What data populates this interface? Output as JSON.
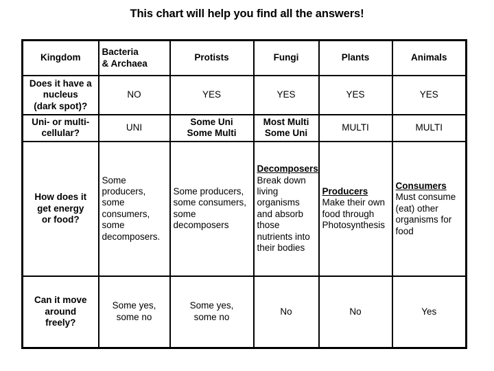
{
  "title": "This chart will help you find all the answers!",
  "chart_data": {
    "type": "table",
    "title": "This chart will help you find all the answers!",
    "columns": [
      "Kingdom",
      "Bacteria\n& Archaea",
      "Protists",
      "Fungi",
      "Plants",
      "Animals"
    ],
    "column_headers": {
      "col0": "Kingdom",
      "col1_line1": "Bacteria",
      "col1_line2": "& Archaea",
      "col2": "Protists",
      "col3": "Fungi",
      "col4": "Plants",
      "col5": "Animals"
    },
    "row_labels": [
      "Does it have a nucleus (dark spot)?",
      "Uni- or multi-cellular?",
      "How does it get energy or food?",
      "Can it move around freely?"
    ],
    "rows": [
      {
        "label_lines": [
          "Does it have a",
          "nucleus",
          "(dark spot)?"
        ],
        "cells": [
          "NO",
          "YES",
          "YES",
          "YES",
          "YES"
        ]
      },
      {
        "label_lines": [
          "Uni- or multi-",
          "cellular?"
        ],
        "cells": [
          "UNI",
          "Some Uni\nSome Multi",
          "Most Multi\nSome Uni",
          "MULTI",
          "MULTI"
        ]
      },
      {
        "label_lines": [
          "How does it",
          "get energy",
          "or food?"
        ],
        "cells": [
          {
            "role": "",
            "text": "Some producers, some consumers, some decomposers."
          },
          {
            "role": "",
            "text": "Some producers, some consumers, some decomposers"
          },
          {
            "role": "Decomposers",
            "text": "Break down living organisms and absorb those nutrients into their bodies"
          },
          {
            "role": "Producers",
            "text": "Make their own food through Photosynthesis"
          },
          {
            "role": "Consumers",
            "text": "Must consume (eat) other organisms for food"
          }
        ]
      },
      {
        "label_lines": [
          "Can it move",
          "around",
          "freely?"
        ],
        "cells": [
          "Some yes,\nsome no",
          "Some yes,\nsome no",
          "No",
          "No",
          "Yes"
        ]
      }
    ],
    "cells": {
      "nucleus": {
        "bacteria": "NO",
        "protists": "YES",
        "fungi": "YES",
        "plants": "YES",
        "animals": "YES"
      },
      "cellular": {
        "bacteria": "UNI",
        "protists_line1": "Some Uni",
        "protists_line2": "Some Multi",
        "fungi_line1": "Most Multi",
        "fungi_line2": "Some Uni",
        "plants": "MULTI",
        "animals": "MULTI"
      },
      "energy": {
        "bacteria": "Some producers, some consumers, some decomposers.",
        "protists": "Some producers, some consumers, some decomposers",
        "fungi_role": "Decomposers",
        "fungi_text": "Break down living organisms and absorb those nutrients into their bodies",
        "plants_role": "Producers",
        "plants_text": "Make their own food through Photosynthesis",
        "animals_role": "Consumers",
        "animals_text": "Must consume (eat) other organisms for food"
      },
      "movement": {
        "bacteria_line1": "Some yes,",
        "bacteria_line2": "some no",
        "protists_line1": "Some yes,",
        "protists_line2": "some no",
        "fungi": "No",
        "plants": "No",
        "animals": "Yes"
      }
    },
    "row_label_lines": {
      "nucleus": [
        "Does it have a",
        "nucleus",
        "(dark spot)?"
      ],
      "cellular": [
        "Uni- or multi-",
        "cellular?"
      ],
      "energy": [
        "How does it",
        "get energy",
        "or food?"
      ],
      "movement": [
        "Can it move",
        "around",
        "freely?"
      ]
    },
    "colors": {
      "background": "#ffffff",
      "text": "#000000",
      "border": "#000000"
    },
    "grid": true,
    "legend": "none"
  }
}
